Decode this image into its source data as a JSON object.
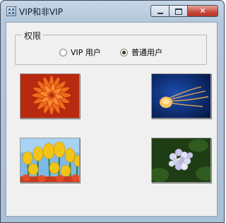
{
  "window": {
    "title": "VIP和非VIP",
    "buttons": {
      "close_glyph": "✕"
    }
  },
  "group": {
    "legend": "权限",
    "options": [
      {
        "label": "VIP 用户",
        "selected": false
      },
      {
        "label": "普通用户",
        "selected": true
      }
    ]
  },
  "images": [
    {
      "name": "chrysanthemum-image"
    },
    {
      "name": "jellyfish-image"
    },
    {
      "name": "tulips-image"
    },
    {
      "name": "hydrangeas-image"
    }
  ]
}
